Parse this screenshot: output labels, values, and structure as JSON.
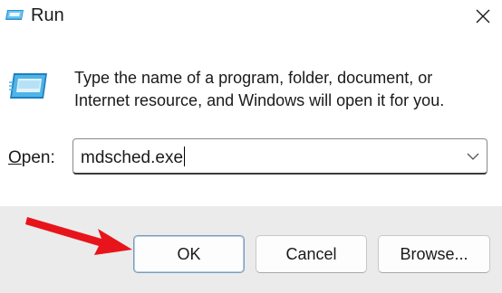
{
  "window": {
    "title": "Run",
    "title_icon": "run-icon",
    "close_icon": "close-icon"
  },
  "body": {
    "icon": "run-icon",
    "description": "Type the name of a program, folder, document, or Internet resource, and Windows will open it for you."
  },
  "open": {
    "label_accel": "O",
    "label_rest": "pen:",
    "value": "mdsched.exe",
    "dropdown_icon": "chevron-down-icon"
  },
  "buttons": {
    "ok": "OK",
    "cancel": "Cancel",
    "browse": "Browse..."
  },
  "annotation": {
    "arrow_icon": "red-arrow-icon",
    "arrow_color": "#e8141b"
  },
  "colors": {
    "footer_bg": "#ebebeb",
    "icon_blue": "#3fa2d8"
  }
}
